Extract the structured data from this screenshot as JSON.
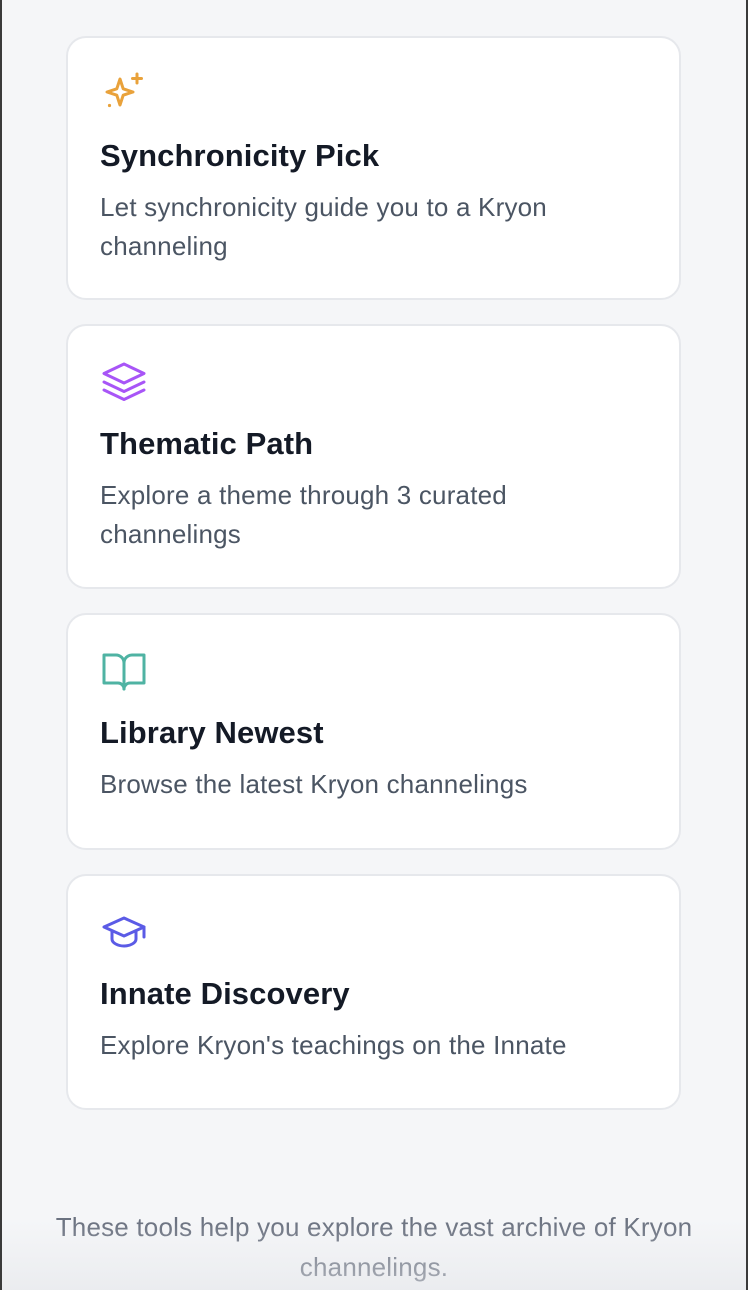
{
  "cards": [
    {
      "icon": "sparkles-icon",
      "icon_color": "#e9a23b",
      "title": "Synchronicity Pick",
      "description": "Let synchronicity guide you to a Kryon channeling"
    },
    {
      "icon": "layers-icon",
      "icon_color": "#a855f7",
      "title": "Thematic Path",
      "description": "Explore a theme through 3 curated channelings"
    },
    {
      "icon": "book-open-icon",
      "icon_color": "#4fb3a3",
      "title": "Library Newest",
      "description": "Browse the latest Kryon channelings"
    },
    {
      "icon": "graduation-cap-icon",
      "icon_color": "#5b5be6",
      "title": "Innate Discovery",
      "description": "Explore Kryon's teachings on the Innate"
    }
  ],
  "footer": {
    "text": "These tools help you explore the vast archive of Kryon channelings."
  },
  "colors": {
    "background": "#f5f6f8",
    "card_background": "#ffffff",
    "card_border": "#e6e8ec",
    "title": "#141a26",
    "description": "#4b5563",
    "footer_text": "#6b7280"
  }
}
